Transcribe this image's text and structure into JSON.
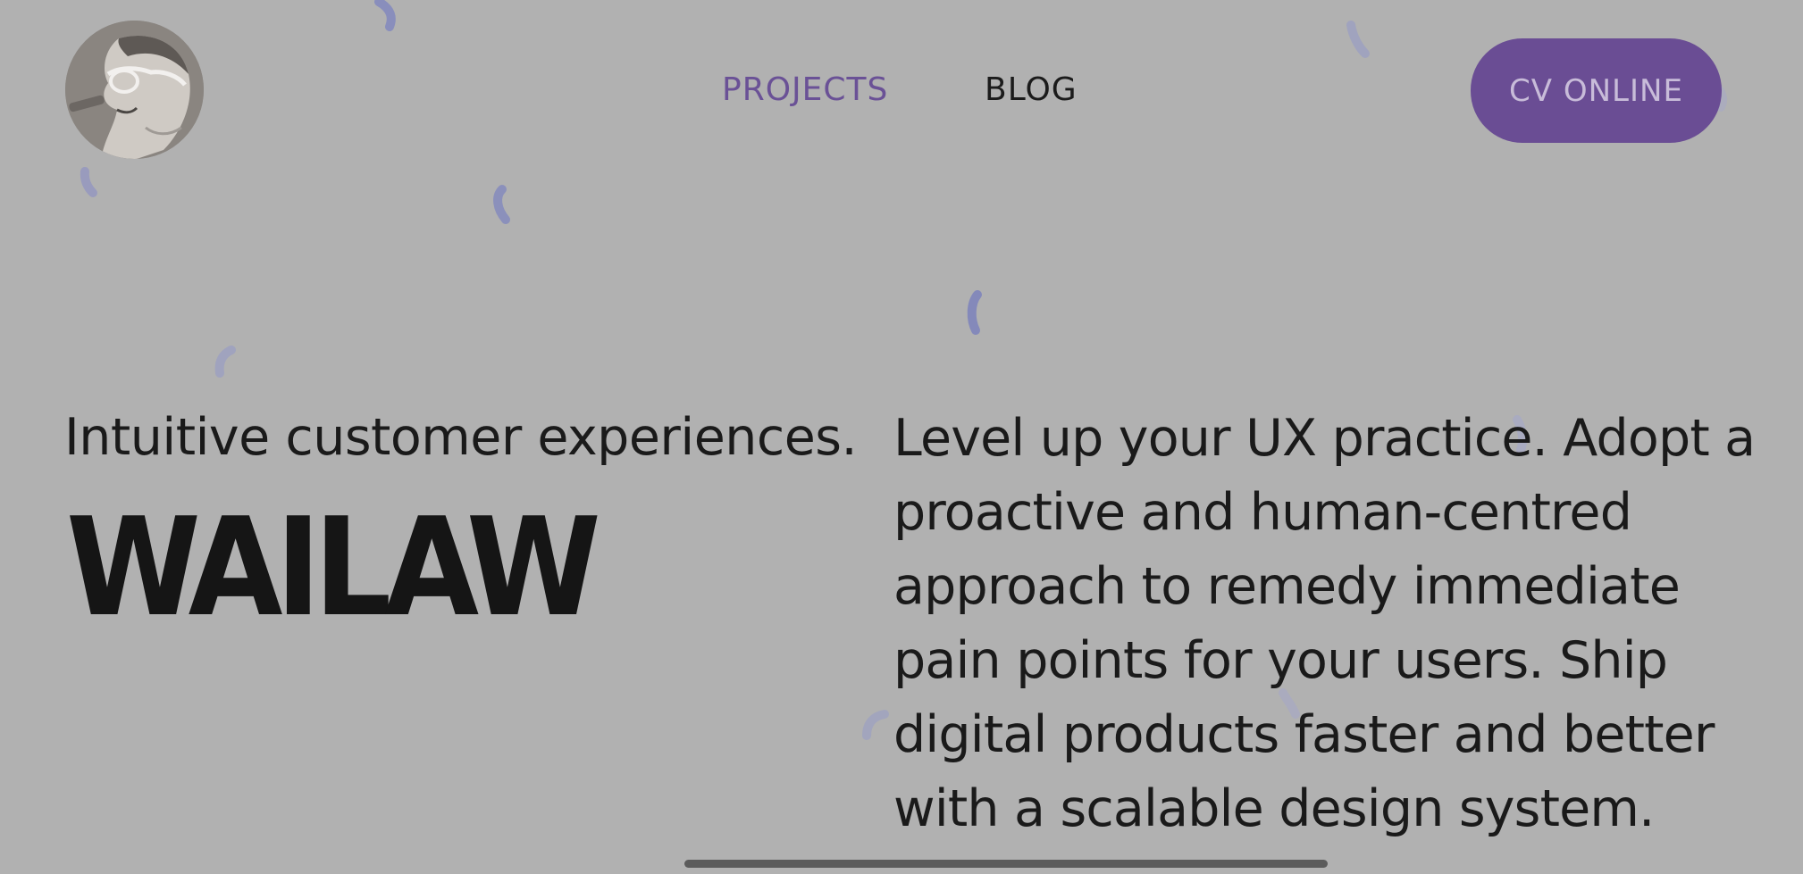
{
  "nav": {
    "projects_label": "PROJECTS",
    "blog_label": "BLOG",
    "cv_button_label": "CV ONLINE"
  },
  "hero": {
    "tagline": "Intuitive customer experiences.",
    "brand": "WAILAW",
    "description": "Level up your UX practice. Adopt a proactive and human-centred approach to remedy immediate pain points for your users. Ship digital products faster and better with a scalable design system."
  },
  "colors": {
    "background": "#b1b1b1",
    "accent": "#6a4d94",
    "nav_active": "#6a5196",
    "confetti": "#8288be",
    "text": "#1a1a1a"
  },
  "icons": {
    "avatar": "profile-photo",
    "decor": "confetti-squiggles"
  }
}
